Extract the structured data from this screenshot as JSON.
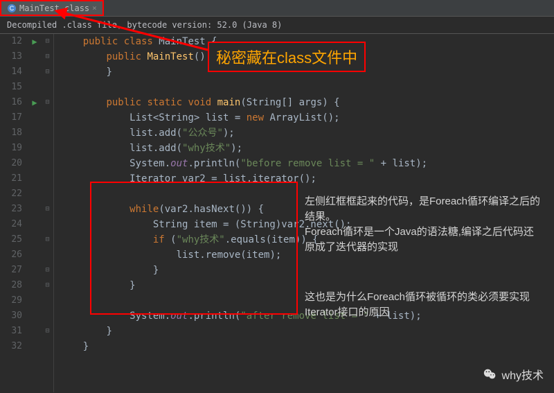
{
  "tab": {
    "label": "MainTest.class",
    "close": "×"
  },
  "info_bar": "Decompiled .class file, bytecode version: 52.0 (Java 8)",
  "callout": "秘密藏在class文件中",
  "annotation1": "左侧红框框起来的代码，是Foreach循环编译之后的结果。\nForeach循环是一个Java的语法糖,编译之后代码还原成了迭代器的实现",
  "annotation2": "这也是为什么Foreach循环被循环的类必须要实现Iterator接口的原因",
  "watermark": "why技术",
  "line_numbers": [
    "12",
    "13",
    "14",
    "15",
    "16",
    "17",
    "18",
    "19",
    "20",
    "21",
    "22",
    "23",
    "24",
    "25",
    "26",
    "27",
    "28",
    "29",
    "30",
    "31",
    "32"
  ],
  "code": {
    "l12": {
      "indent": "    ",
      "t": [
        {
          "c": "kw",
          "v": "public class "
        },
        {
          "c": "cls",
          "v": "MainTest {"
        }
      ]
    },
    "l13": {
      "indent": "        ",
      "t": [
        {
          "c": "kw",
          "v": "public "
        },
        {
          "c": "method",
          "v": "MainTest"
        },
        {
          "c": "cls",
          "v": "() {"
        }
      ]
    },
    "l14": {
      "indent": "        ",
      "t": [
        {
          "c": "cls",
          "v": "}"
        }
      ]
    },
    "l15": {
      "indent": "",
      "t": []
    },
    "l16": {
      "indent": "        ",
      "t": [
        {
          "c": "kw",
          "v": "public static void "
        },
        {
          "c": "method",
          "v": "main"
        },
        {
          "c": "cls",
          "v": "(String[] args) {"
        }
      ]
    },
    "l17": {
      "indent": "            ",
      "t": [
        {
          "c": "cls",
          "v": "List<String> list = "
        },
        {
          "c": "kw",
          "v": "new "
        },
        {
          "c": "cls",
          "v": "ArrayList();"
        }
      ]
    },
    "l18": {
      "indent": "            ",
      "t": [
        {
          "c": "cls",
          "v": "list.add("
        },
        {
          "c": "str",
          "v": "\"公众号\""
        },
        {
          "c": "cls",
          "v": ");"
        }
      ]
    },
    "l19": {
      "indent": "            ",
      "t": [
        {
          "c": "cls",
          "v": "list.add("
        },
        {
          "c": "str",
          "v": "\"why技术\""
        },
        {
          "c": "cls",
          "v": ");"
        }
      ]
    },
    "l20": {
      "indent": "            ",
      "t": [
        {
          "c": "cls",
          "v": "System."
        },
        {
          "c": "field",
          "v": "out"
        },
        {
          "c": "cls",
          "v": ".println("
        },
        {
          "c": "str",
          "v": "\"before remove list = \""
        },
        {
          "c": "cls",
          "v": " + list);"
        }
      ]
    },
    "l21": {
      "indent": "            ",
      "t": [
        {
          "c": "cls",
          "v": "Iterator var2 = list.iterator();"
        }
      ]
    },
    "l22": {
      "indent": "",
      "t": []
    },
    "l23": {
      "indent": "            ",
      "t": [
        {
          "c": "kw",
          "v": "while"
        },
        {
          "c": "cls",
          "v": "(var2.hasNext()) {"
        }
      ]
    },
    "l24": {
      "indent": "                ",
      "t": [
        {
          "c": "cls",
          "v": "String item = (String)var2.next();"
        }
      ]
    },
    "l25": {
      "indent": "                ",
      "t": [
        {
          "c": "kw",
          "v": "if "
        },
        {
          "c": "cls",
          "v": "("
        },
        {
          "c": "str",
          "v": "\"why技术\""
        },
        {
          "c": "cls",
          "v": ".equals(item)) {"
        }
      ]
    },
    "l26": {
      "indent": "                    ",
      "t": [
        {
          "c": "cls",
          "v": "list.remove(item);"
        }
      ]
    },
    "l27": {
      "indent": "                ",
      "t": [
        {
          "c": "cls",
          "v": "}"
        }
      ]
    },
    "l28": {
      "indent": "            ",
      "t": [
        {
          "c": "cls",
          "v": "}"
        }
      ]
    },
    "l29": {
      "indent": "",
      "t": []
    },
    "l30": {
      "indent": "            ",
      "t": [
        {
          "c": "cls",
          "v": "System."
        },
        {
          "c": "field",
          "v": "out"
        },
        {
          "c": "cls",
          "v": ".println("
        },
        {
          "c": "str",
          "v": "\"after remove list = \""
        },
        {
          "c": "cls",
          "v": " + list);"
        }
      ]
    },
    "l31": {
      "indent": "        ",
      "t": [
        {
          "c": "cls",
          "v": "}"
        }
      ]
    },
    "l32": {
      "indent": "    ",
      "t": [
        {
          "c": "cls",
          "v": "}"
        }
      ]
    }
  }
}
